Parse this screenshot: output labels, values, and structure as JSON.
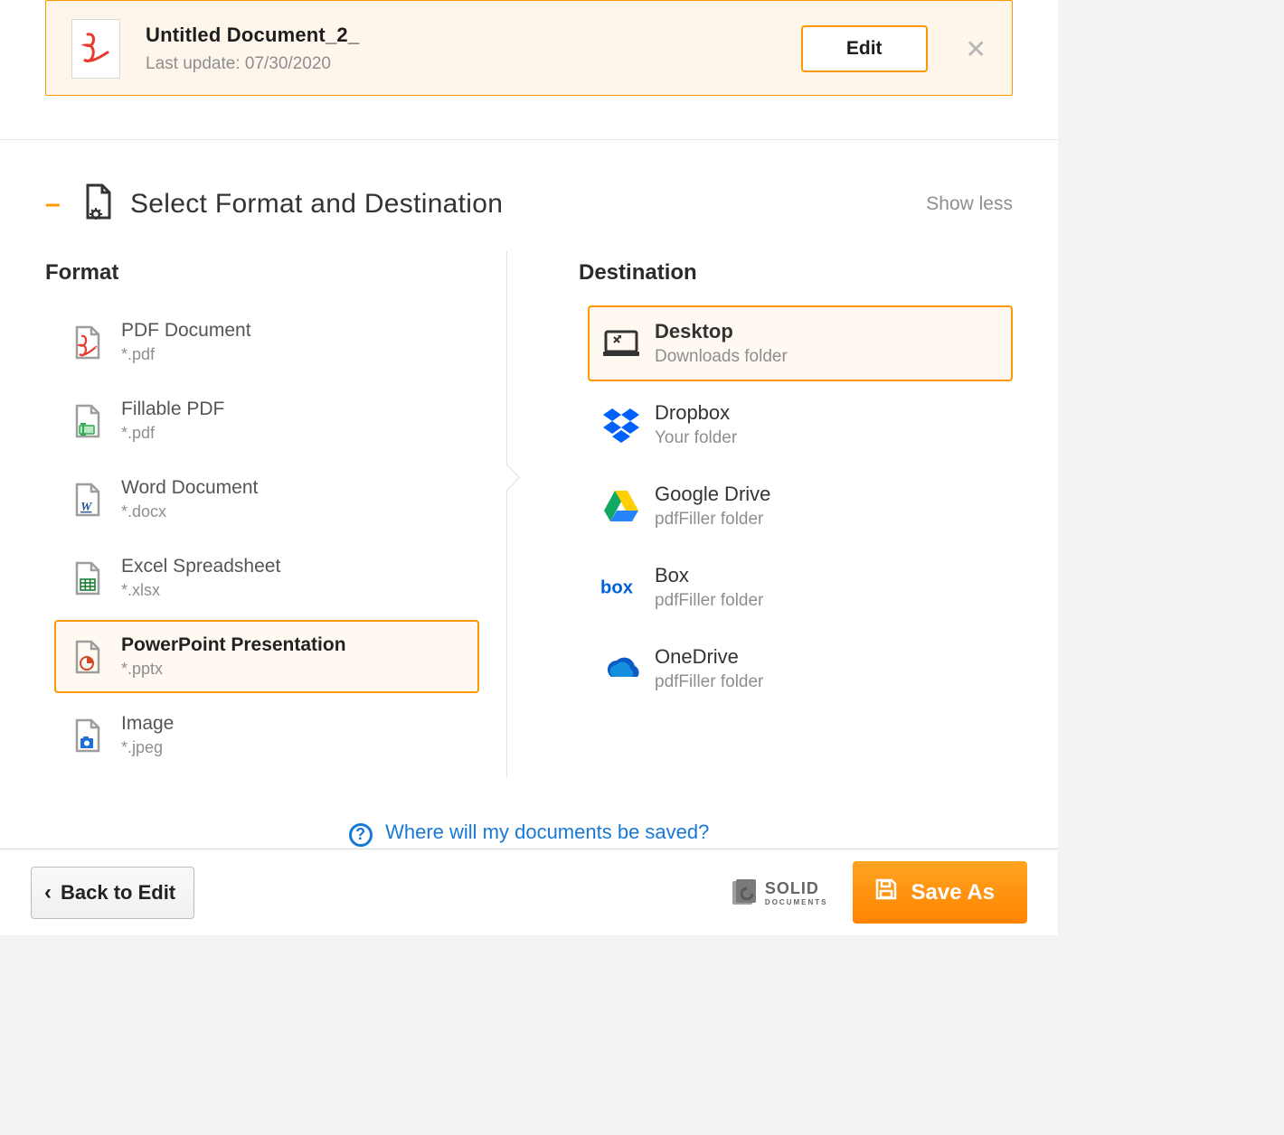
{
  "doc": {
    "title": "Untitled Document_2_",
    "last_update_prefix": "Last update: ",
    "last_update": "07/30/2020",
    "edit_label": "Edit"
  },
  "section": {
    "title": "Select Format and Destination",
    "show_less": "Show less"
  },
  "format": {
    "heading": "Format",
    "items": [
      {
        "name": "PDF Document",
        "ext": "*.pdf",
        "icon": "pdf"
      },
      {
        "name": "Fillable PDF",
        "ext": "*.pdf",
        "icon": "fillable"
      },
      {
        "name": "Word Document",
        "ext": "*.docx",
        "icon": "word"
      },
      {
        "name": "Excel Spreadsheet",
        "ext": "*.xlsx",
        "icon": "excel"
      },
      {
        "name": "PowerPoint Presentation",
        "ext": "*.pptx",
        "icon": "ppt"
      },
      {
        "name": "Image",
        "ext": "*.jpeg",
        "icon": "image"
      }
    ],
    "selected_index": 4
  },
  "destination": {
    "heading": "Destination",
    "items": [
      {
        "name": "Desktop",
        "sub": "Downloads folder",
        "icon": "desktop"
      },
      {
        "name": "Dropbox",
        "sub": "Your folder",
        "icon": "dropbox"
      },
      {
        "name": "Google Drive",
        "sub": "pdfFiller folder",
        "icon": "gdrive"
      },
      {
        "name": "Box",
        "sub": "pdfFiller folder",
        "icon": "box"
      },
      {
        "name": "OneDrive",
        "sub": "pdfFiller folder",
        "icon": "onedrive"
      }
    ],
    "selected_index": 0
  },
  "help": {
    "text": "Where will my documents be saved?"
  },
  "footer": {
    "back": "Back to Edit",
    "brand_main": "SOLID",
    "brand_sub": "DOCUMENTS",
    "save": "Save As"
  }
}
